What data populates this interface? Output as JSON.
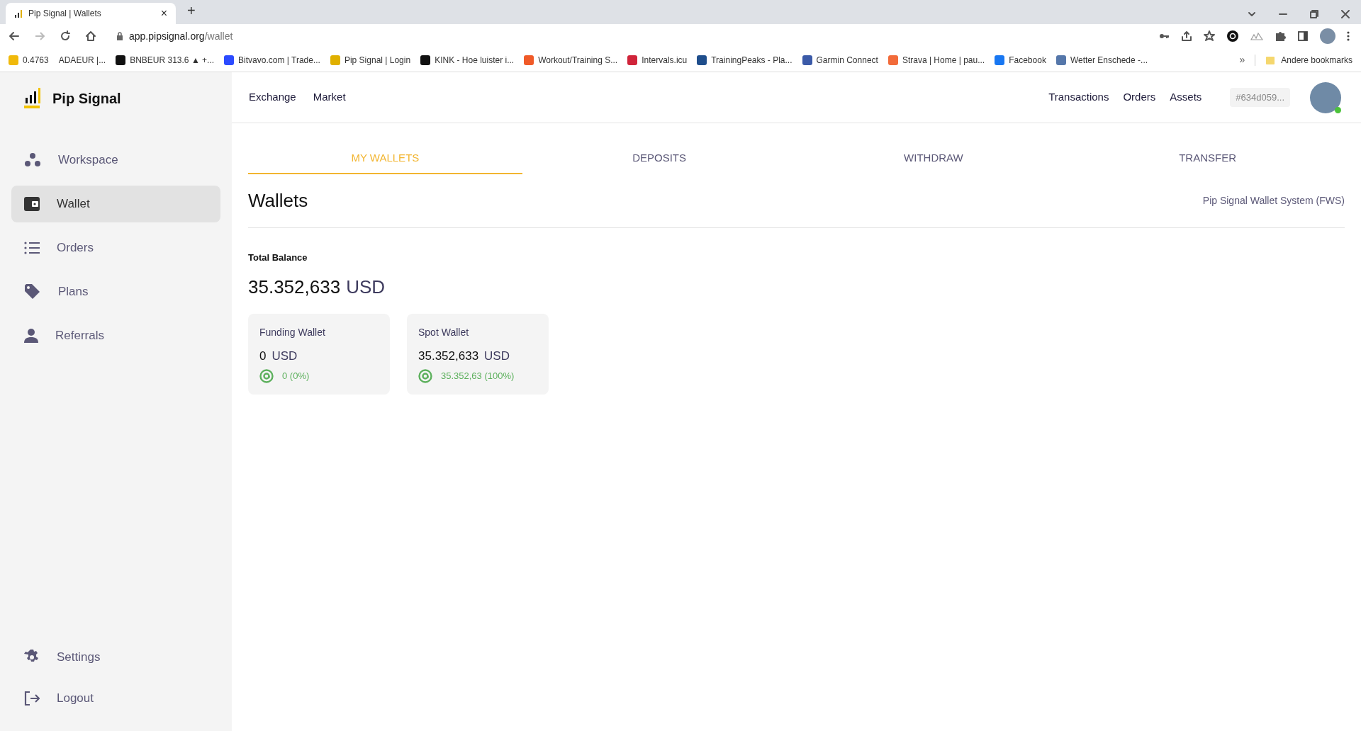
{
  "browser": {
    "tab": {
      "title": "Pip Signal | Wallets",
      "close": "×"
    },
    "new_tab": "+",
    "address": {
      "host": "app.pipsignal.org",
      "path": "/wallet"
    },
    "bookmarks": [
      {
        "label": "0.4763",
        "color": "#f0b90b"
      },
      {
        "label": "ADAEUR |..."
      },
      {
        "label": "BNBEUR 313.6 ▲ +...",
        "color": "#111111"
      },
      {
        "label": "Bitvavo.com | Trade...",
        "color": "#2c4bff"
      },
      {
        "label": "Pip Signal | Login",
        "color": "#e0b000"
      },
      {
        "label": "KINK - Hoe luister i...",
        "color": "#111111"
      },
      {
        "label": "Workout/Training S...",
        "color": "#f05a28"
      },
      {
        "label": "Intervals.icu",
        "color": "#d0243a"
      },
      {
        "label": "TrainingPeaks - Pla...",
        "color": "#1f4e8c"
      },
      {
        "label": "Garmin Connect",
        "color": "#3b5aa8"
      },
      {
        "label": "Strava | Home | pau...",
        "color": "#f26b3a"
      },
      {
        "label": "Facebook",
        "color": "#1877f2"
      },
      {
        "label": "Wetter Enschede -...",
        "color": "#5577aa"
      }
    ],
    "more": "»",
    "other_bookmarks": "Andere bookmarks"
  },
  "app": {
    "brand": "Pip Signal",
    "sidebar": {
      "items": [
        {
          "label": "Workspace",
          "selected": false
        },
        {
          "label": "Wallet",
          "selected": true
        },
        {
          "label": "Orders",
          "selected": false
        },
        {
          "label": "Plans",
          "selected": false
        },
        {
          "label": "Referrals",
          "selected": false
        }
      ],
      "bottom_items": [
        {
          "label": "Settings"
        },
        {
          "label": "Logout"
        }
      ]
    },
    "header": {
      "left_links": [
        "Exchange",
        "Market"
      ],
      "right_links": [
        "Transactions",
        "Orders",
        "Assets"
      ],
      "account_id": "#634d059...",
      "avatar_online": true
    },
    "tabs": [
      {
        "label": "MY WALLETS",
        "selected": true
      },
      {
        "label": "DEPOSITS",
        "selected": false
      },
      {
        "label": "WITHDRAW",
        "selected": false
      },
      {
        "label": "TRANSFER",
        "selected": false
      }
    ],
    "title": "Wallets",
    "system": "Pip Signal Wallet System (FWS)",
    "total": {
      "label": "Total Balance",
      "amount": "35.352,633",
      "currency": "USD"
    },
    "wallets": [
      {
        "name": "Funding Wallet",
        "amount": "0",
        "currency": "USD",
        "share": "0 (0%)"
      },
      {
        "name": "Spot Wallet",
        "amount": "35.352,633",
        "currency": "USD",
        "share": "35.352,63 (100%)"
      }
    ]
  }
}
